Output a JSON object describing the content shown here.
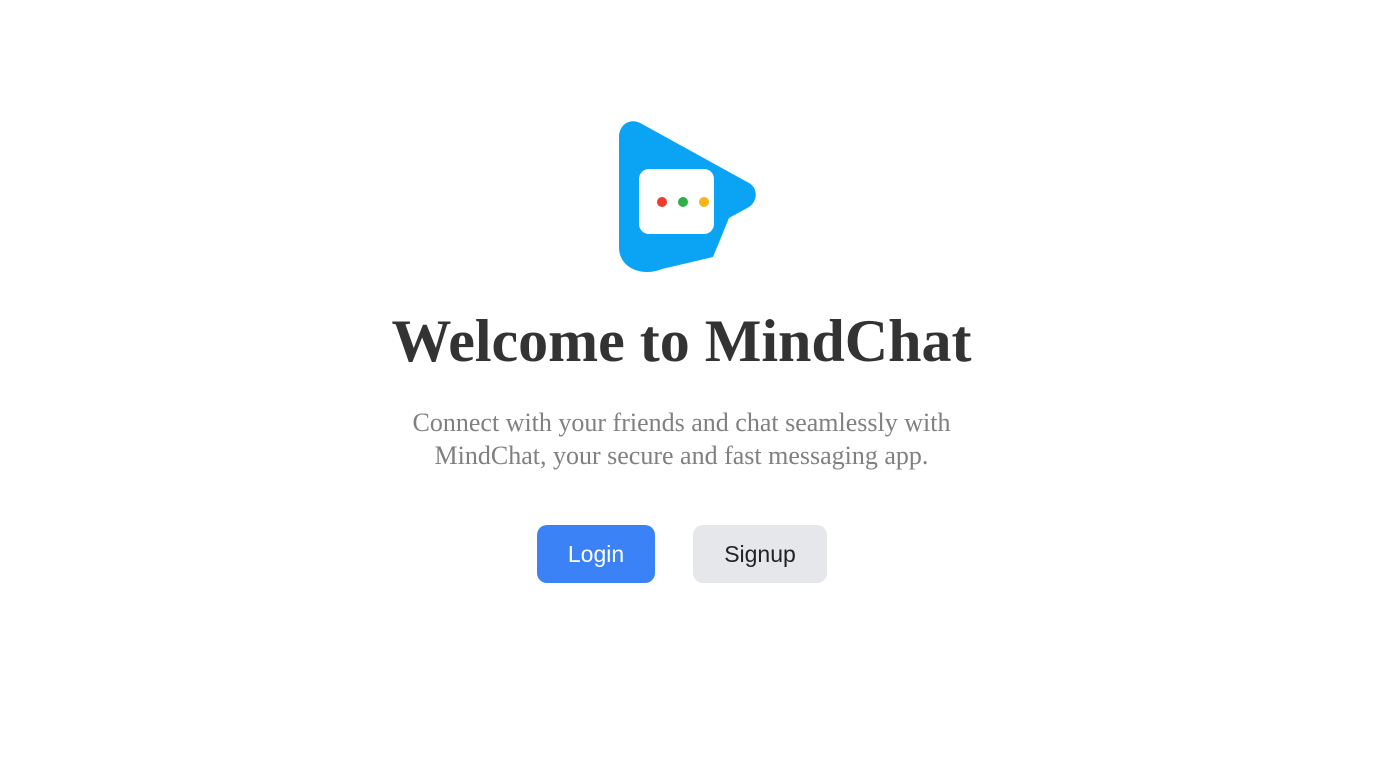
{
  "logo": {
    "icon": "mindchat-chat-play-logo",
    "brand_color": "#0ba4f5",
    "dot_colors": [
      "#ef3b2c",
      "#2fae4a",
      "#f6b416"
    ]
  },
  "hero": {
    "title": "Welcome to MindChat",
    "subtitle_line1": "Connect with your friends and chat seamlessly with",
    "subtitle_line2": "MindChat, your secure and fast messaging app."
  },
  "actions": {
    "login_label": "Login",
    "signup_label": "Signup",
    "login_color": "#3b82f6",
    "signup_color": "#e5e7eb"
  }
}
